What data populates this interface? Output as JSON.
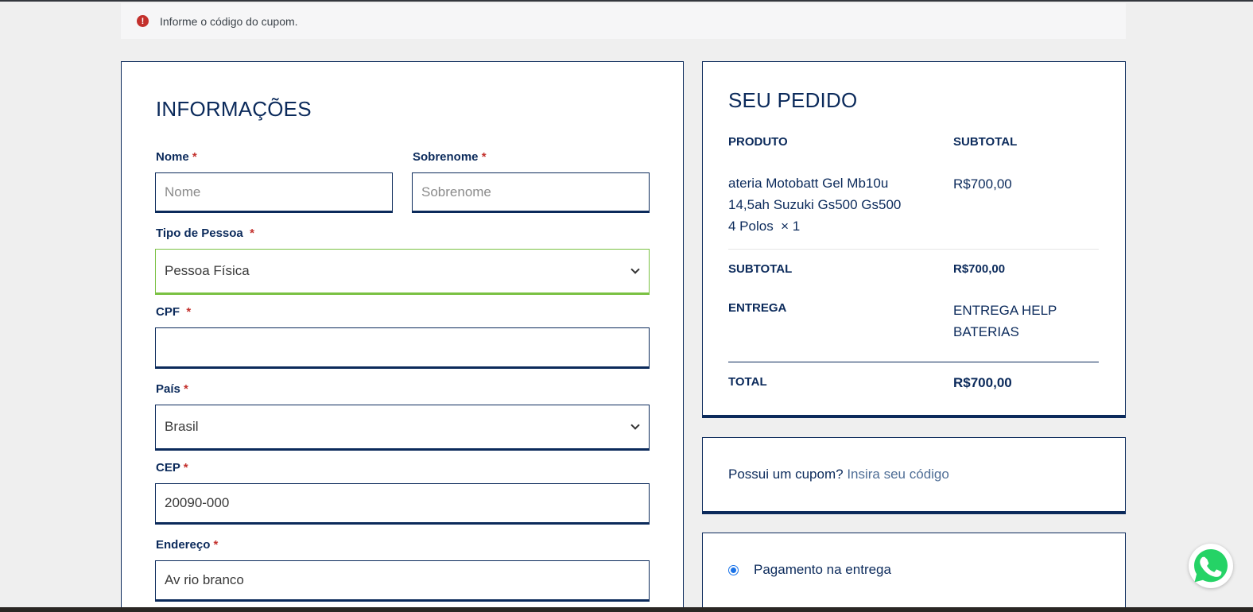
{
  "notice": {
    "icon": "error-icon",
    "text": "Informe o código do cupom."
  },
  "billing": {
    "title": "INFORMAÇÕES",
    "required_mark": "*",
    "first_name": {
      "label": "Nome",
      "placeholder": "Nome",
      "value": ""
    },
    "last_name": {
      "label": "Sobrenome",
      "placeholder": "Sobrenome",
      "value": ""
    },
    "person_type": {
      "label": "Tipo de Pessoa",
      "value": "Pessoa Física"
    },
    "cpf": {
      "label": "CPF",
      "value": ""
    },
    "country": {
      "label": "País",
      "value": "Brasil"
    },
    "cep": {
      "label": "CEP",
      "value": "20090-000"
    },
    "address": {
      "label": "Endereço",
      "value": "Av rio branco"
    }
  },
  "order": {
    "title": "SEU PEDIDO",
    "col_product": "PRODUTO",
    "col_subtotal": "SUBTOTAL",
    "item": {
      "name_line1": "ateria Motobatt Gel Mb10u",
      "name_line2": "14,5ah Suzuki Gs500 Gs500",
      "name_line3": "4 Polos",
      "qty": "× 1",
      "price": "R$700,00"
    },
    "subtotal_label": "SUBTOTAL",
    "subtotal_value": "R$700,00",
    "shipping_label": "ENTREGA",
    "shipping_line1": "ENTREGA HELP",
    "shipping_line2": "BATERIAS",
    "total_label": "TOTAL",
    "total_value": "R$700,00"
  },
  "coupon": {
    "question": "Possui um cupom?",
    "link": "Insira seu código"
  },
  "payment": {
    "option": "Pagamento na entrega",
    "selected": true
  },
  "colors": {
    "primary": "#0b2a5b",
    "error": "#c3302c",
    "valid": "#7ac142",
    "whatsapp": "#25d366"
  }
}
